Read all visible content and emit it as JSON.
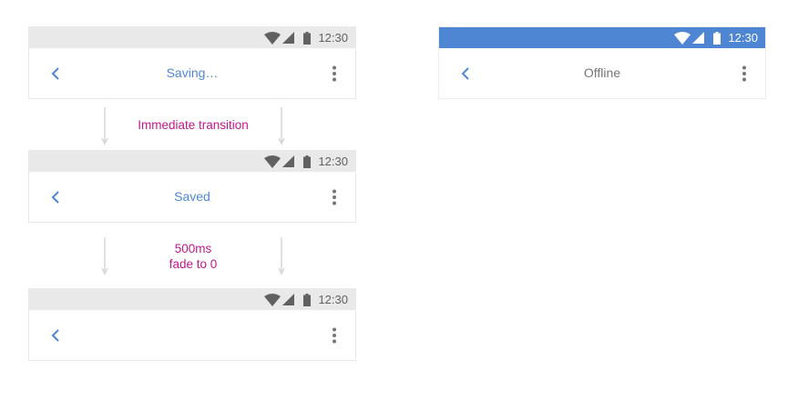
{
  "status_time": "12:30",
  "colors": {
    "accent": "#4f86d4",
    "label": "#c2188b",
    "statusbar_gray": "#e9e9e9",
    "statusbar_blue": "#4f86d4"
  },
  "phones": [
    {
      "title": "Saving…",
      "statusbar": "gray"
    },
    {
      "title": "Saved",
      "statusbar": "gray"
    },
    {
      "title": "",
      "statusbar": "gray"
    },
    {
      "title": "Offline",
      "statusbar": "blue"
    }
  ],
  "transitions": {
    "first": "Immediate transition",
    "second_line1": "500ms",
    "second_line2": "fade to 0"
  },
  "icons": [
    "wifi-icon",
    "signal-icon",
    "battery-icon",
    "back-arrow-icon",
    "more-vert-icon"
  ]
}
